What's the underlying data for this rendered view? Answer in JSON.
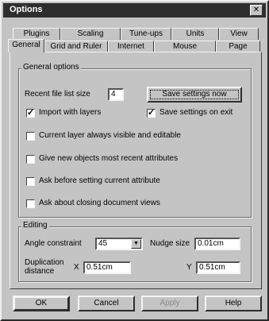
{
  "window": {
    "title": "Options",
    "close_glyph": "✕"
  },
  "tabs": {
    "back": [
      "Plugins",
      "Scaling",
      "Tune-ups",
      "Units",
      "View"
    ],
    "front": [
      "General",
      "Grid and Ruler",
      "Internet",
      "Mouse",
      "Page"
    ]
  },
  "general": {
    "legend": "General options",
    "recent_label": "Recent file list size",
    "recent_value": "4",
    "save_now_label": "Save settings now",
    "import_layers": {
      "label": "Import with layers",
      "checked": true
    },
    "save_on_exit": {
      "label": "Save settings on exit",
      "checked": true
    },
    "options": [
      {
        "label": "Current layer always visible and editable",
        "checked": false
      },
      {
        "label": "Give new objects most recent attributes",
        "checked": false
      },
      {
        "label": "Ask before setting current attribute",
        "checked": false
      },
      {
        "label": "Ask about closing document views",
        "checked": false
      }
    ]
  },
  "editing": {
    "legend": "Editing",
    "angle_label": "Angle constraint",
    "angle_value": "45",
    "nudge_label": "Nudge size",
    "nudge_value": "0.01cm",
    "dup_label_line1": "Duplication",
    "dup_label_line2": "distance",
    "x_label": "X",
    "x_value": "0.51cm",
    "y_label": "Y",
    "y_value": "0.51cm"
  },
  "buttons": {
    "ok": "OK",
    "cancel": "Cancel",
    "apply": "Apply",
    "help": "Help"
  },
  "check_glyph": "✓",
  "dropdown_glyph": "▼"
}
